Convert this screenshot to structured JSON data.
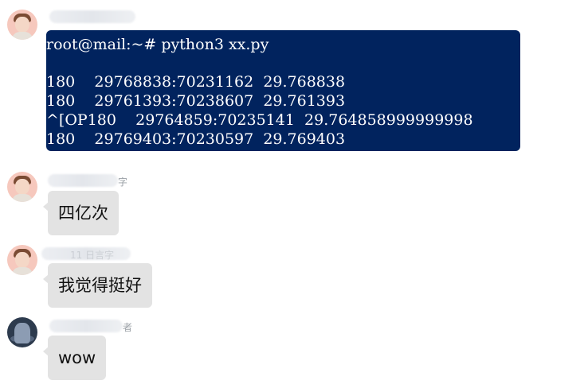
{
  "terminal": {
    "lines": [
      "root@mail:~# python3 xx.py",
      "",
      "180    29768838:70231162  29.768838",
      "180    29761393:70238607  29.761393",
      "^[OP180    29764859:70235141  29.764858999999998",
      "180    29769403:70230597  29.769403"
    ]
  },
  "messages": [
    {
      "name_tail": "字",
      "text": "四亿次"
    },
    {
      "name_tail": "11 日言字",
      "text": "我觉得挺好"
    },
    {
      "name_tail": "者",
      "text": "wow"
    }
  ],
  "colors": {
    "terminal_bg": "#01235e",
    "bubble_bg": "#e3e3e3"
  }
}
